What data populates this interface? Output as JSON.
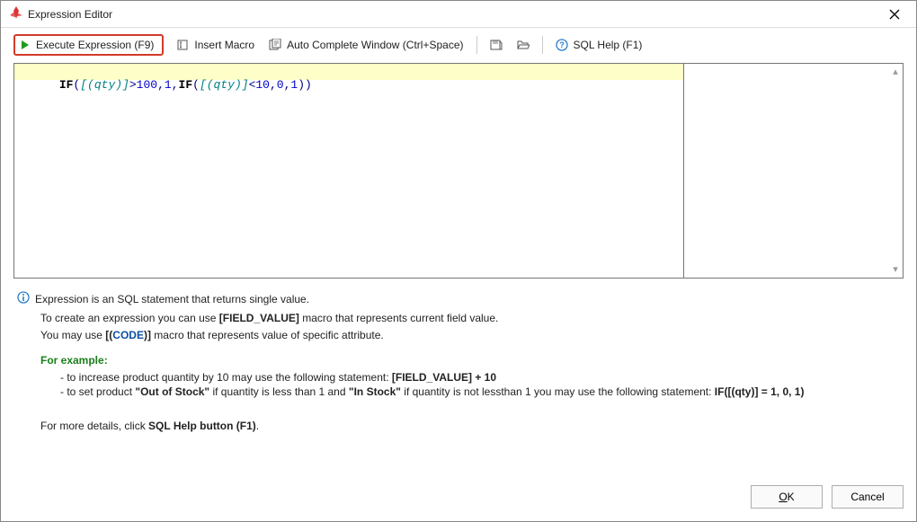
{
  "window": {
    "title": "Expression Editor"
  },
  "toolbar": {
    "execute": "Execute Expression (F9)",
    "insert_macro": "Insert Macro",
    "auto_complete": "Auto Complete Window (Ctrl+Space)",
    "sql_help": "SQL Help (F1)"
  },
  "editor": {
    "tokens": {
      "if": "IF",
      "lpar": "(",
      "rpar": ")",
      "macro_open": "[(",
      "macro_name": "qty",
      "macro_close": ")]",
      "gt": ">",
      "lt": "<",
      "comma": ",",
      "n100": "100",
      "n10": "10",
      "n1": "1",
      "n0": "0"
    }
  },
  "help": {
    "hint": "Expression is an SQL statement that returns single value.",
    "line1_a": "To create an expression you can use ",
    "line1_b": "[FIELD_VALUE]",
    "line1_c": " macro that represents current field value.",
    "line2_a": "You may use ",
    "line2_b": "[(",
    "line2_c": "CODE",
    "line2_d": ")]",
    "line2_e": " macro that represents value of specific attribute.",
    "example_label": "For example:",
    "ex1_a": "to increase product quantity by 10 may use the following statement: ",
    "ex1_b": "[FIELD_VALUE] + 10",
    "ex2_a": "to set product ",
    "ex2_b": "\"Out of Stock\"",
    "ex2_c": " if quantity is less than 1 and ",
    "ex2_d": "\"In Stock\"",
    "ex2_e": " if quantity is not lessthan 1 you may use the following statement: ",
    "ex2_f": "IF([(qty)] = 1, 0, 1)",
    "details_a": "For more details, click ",
    "details_b": "SQL Help button (F1)",
    "details_c": "."
  },
  "buttons": {
    "ok_u": "O",
    "ok_rest": "K",
    "cancel": "Cancel"
  }
}
